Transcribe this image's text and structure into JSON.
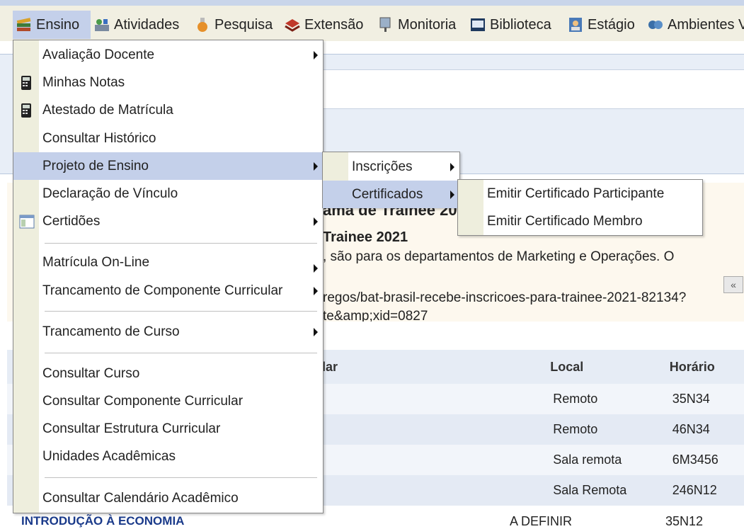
{
  "menubar": {
    "items": [
      {
        "label": "Ensino",
        "icon": "books-icon"
      },
      {
        "label": "Atividades",
        "icon": "activities-icon"
      },
      {
        "label": "Pesquisa",
        "icon": "flask-icon"
      },
      {
        "label": "Extensão",
        "icon": "extension-icon"
      },
      {
        "label": "Monitoria",
        "icon": "monitor-icon"
      },
      {
        "label": "Biblioteca",
        "icon": "library-icon"
      },
      {
        "label": "Estágio",
        "icon": "internship-icon"
      },
      {
        "label": "Ambientes V",
        "icon": "environments-icon"
      }
    ]
  },
  "dropdown": {
    "items": [
      {
        "label": "Avaliação Docente",
        "submenu": true
      },
      {
        "label": "Minhas Notas",
        "icon": "calculator-icon"
      },
      {
        "label": "Atestado de Matrícula",
        "icon": "calculator-icon"
      },
      {
        "label": "Consultar Histórico"
      },
      {
        "label": "Projeto de Ensino",
        "submenu": true
      },
      {
        "label": "Declaração de Vínculo"
      },
      {
        "label": "Certidões",
        "submenu": true,
        "icon": "document-icon"
      },
      {
        "label": "Matrícula On-Line",
        "submenu": true
      },
      {
        "label": "Trancamento de Componente Curricular",
        "submenu": true
      },
      {
        "label": "Trancamento de Curso",
        "submenu": true
      },
      {
        "label": "Consultar Curso"
      },
      {
        "label": "Consultar Componente Curricular"
      },
      {
        "label": "Consultar Estrutura Curricular"
      },
      {
        "label": "Unidades Acadêmicas"
      },
      {
        "label": "Consultar Calendário Acadêmico"
      }
    ]
  },
  "submenu_projeto": {
    "items": [
      {
        "label": "Inscrições"
      },
      {
        "label": "Certificados"
      }
    ]
  },
  "submenu_certificados": {
    "items": [
      {
        "label": "Emitir Certificado Participante"
      },
      {
        "label": "Emitir Certificado Membro"
      }
    ]
  },
  "news": {
    "title_fragment": "ama de Trainee 20",
    "subtitle_fragment": "Trainee 2021",
    "body_fragment": ", são para os departamentos de Marketing e Operações. O",
    "link_fragment1": "regos/bat-brasil-recebe-inscricoes-para-trainee-2021-82134?",
    "link_fragment2": "te&amp;xid=0827",
    "collapse_label": "«"
  },
  "schedule": {
    "headers": [
      "lar",
      "Local",
      "Horário"
    ],
    "rows": [
      {
        "local": "Remoto",
        "horario": "35N34"
      },
      {
        "local": "Remoto",
        "horario": "46N34"
      },
      {
        "local": "Sala remota",
        "horario": "6M3456"
      },
      {
        "local": "Sala Remota",
        "horario": "246N12"
      },
      {
        "local": "A DEFINIR",
        "horario": "35N12"
      }
    ],
    "last_row_course_fragment": "INTRODUÇÃO À ECONOMIA"
  },
  "colors": {
    "highlight": "#c4d0ea",
    "menubar": "#f1efe2",
    "gutter": "#eeeedd"
  }
}
